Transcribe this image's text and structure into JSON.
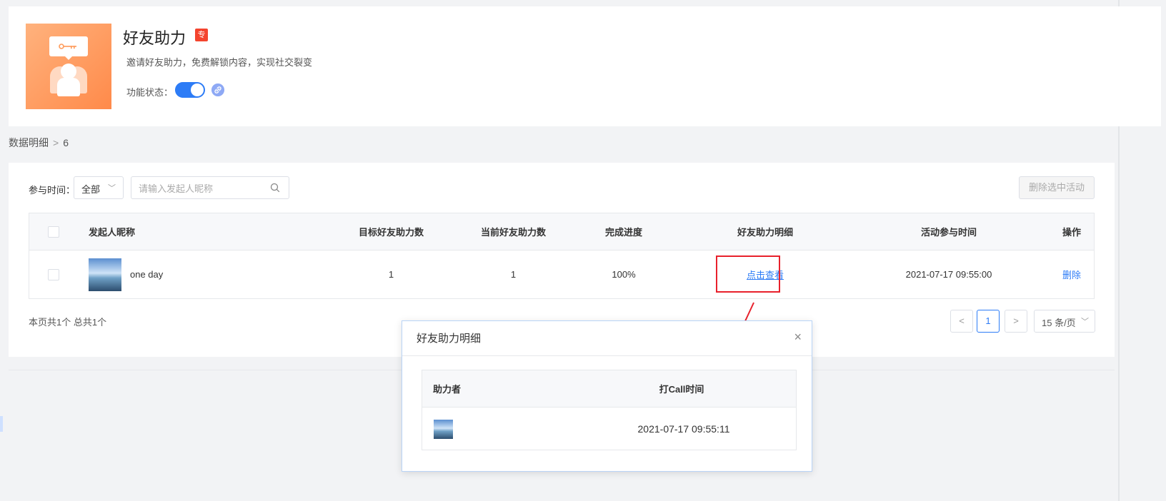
{
  "header": {
    "title": "好友助力",
    "badge": "专",
    "description": "邀请好友助力，免费解锁内容，实现社交裂变",
    "status_label": "功能状态：",
    "status_on": true
  },
  "breadcrumb": {
    "parent": "数据明细",
    "separator": ">",
    "current": "6"
  },
  "filters": {
    "time_label": "参与时间：",
    "time_select_value": "全部",
    "search_placeholder": "请输入发起人昵称",
    "delete_selected_label": "删除选中活动"
  },
  "table": {
    "columns": [
      "发起人昵称",
      "目标好友助力数",
      "当前好友助力数",
      "完成进度",
      "好友助力明细",
      "活动参与时间",
      "操作"
    ],
    "rows": [
      {
        "nickname": "one day",
        "target": "1",
        "current": "1",
        "progress": "100%",
        "detail_link": "点击查看",
        "time": "2021-07-17 09:55:00",
        "action": "删除"
      }
    ]
  },
  "pagination": {
    "info": "本页共1个 总共1个",
    "prev": "<",
    "page": "1",
    "next": ">",
    "page_size": "15 条/页"
  },
  "modal": {
    "title": "好友助力明细",
    "close": "×",
    "columns": [
      "助力者",
      "打Call时间"
    ],
    "rows": [
      {
        "time": "2021-07-17 09:55:11"
      }
    ]
  },
  "colors": {
    "accent": "#2d7cf6",
    "highlight": "#e8212c",
    "badge": "#f4442e"
  }
}
